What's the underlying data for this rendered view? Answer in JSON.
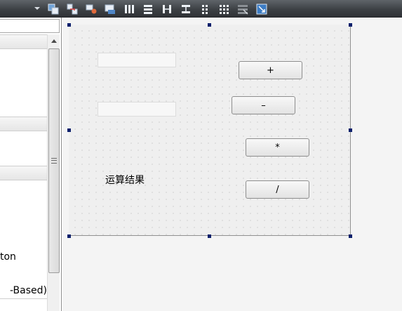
{
  "toolbar": {
    "buttons": [
      "edit-widgets-icon",
      "edit-signals-slots-icon",
      "edit-buddies-icon",
      "edit-tab-order-icon",
      "layout-horizontal-icon",
      "layout-vertical-icon",
      "layout-horizontal-splitter-icon",
      "layout-vertical-splitter-icon",
      "layout-form-icon",
      "layout-grid-icon",
      "break-layout-icon",
      "adjust-size-icon"
    ]
  },
  "widget_box": {
    "filter_value": "",
    "items": {
      "push_button": "ton",
      "list_view": "-Based)"
    }
  },
  "form": {
    "buttons": {
      "add": "+",
      "subtract": "–",
      "multiply": "*",
      "divide": "/"
    },
    "inputs": {
      "first_operand": "",
      "second_operand": ""
    },
    "result_label": "运算结果"
  },
  "colors": {
    "toolbar_bg": "#3d4145",
    "selection_handle": "#0a1f6b",
    "canvas_bg": "#efefef"
  }
}
